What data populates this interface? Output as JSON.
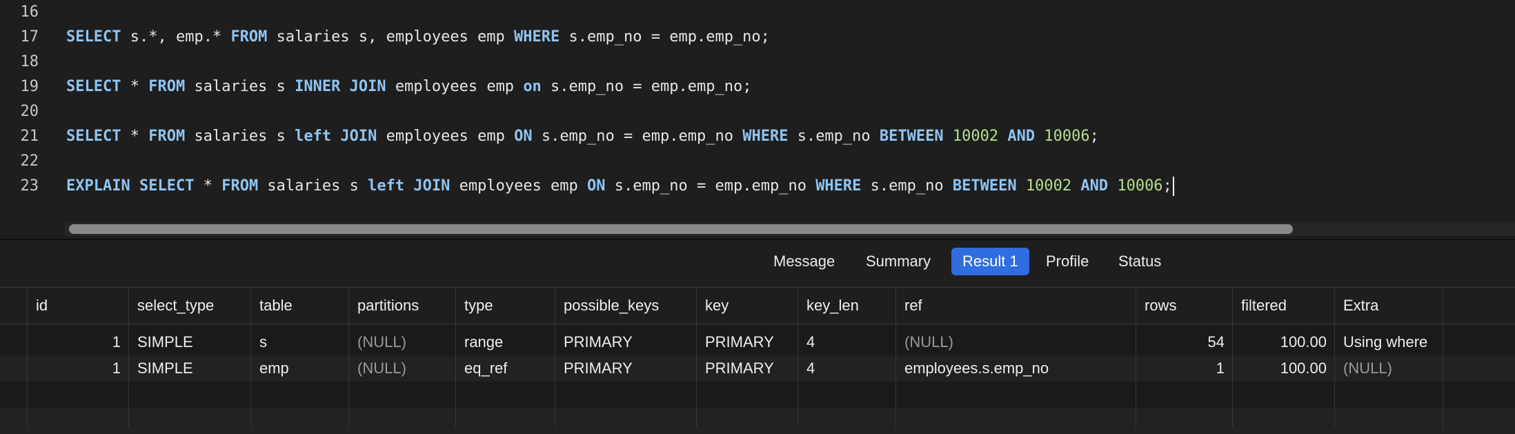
{
  "editor": {
    "lines": [
      {
        "no": "16",
        "tokens": []
      },
      {
        "no": "17",
        "tokens": [
          {
            "t": "SELECT",
            "c": "kw"
          },
          {
            "t": " s.*, emp.* ",
            "c": ""
          },
          {
            "t": "FROM",
            "c": "kw"
          },
          {
            "t": " salaries s, employees emp ",
            "c": ""
          },
          {
            "t": "WHERE",
            "c": "kw"
          },
          {
            "t": " s.emp_no = emp.emp_no;",
            "c": ""
          }
        ]
      },
      {
        "no": "18",
        "tokens": []
      },
      {
        "no": "19",
        "tokens": [
          {
            "t": "SELECT",
            "c": "kw"
          },
          {
            "t": " * ",
            "c": ""
          },
          {
            "t": "FROM",
            "c": "kw"
          },
          {
            "t": " salaries s ",
            "c": ""
          },
          {
            "t": "INNER JOIN",
            "c": "kw"
          },
          {
            "t": " employees emp ",
            "c": ""
          },
          {
            "t": "on",
            "c": "kw"
          },
          {
            "t": " s.emp_no = emp.emp_no;",
            "c": ""
          }
        ]
      },
      {
        "no": "20",
        "tokens": []
      },
      {
        "no": "21",
        "tokens": [
          {
            "t": "SELECT",
            "c": "kw"
          },
          {
            "t": " * ",
            "c": ""
          },
          {
            "t": "FROM",
            "c": "kw"
          },
          {
            "t": " salaries s ",
            "c": ""
          },
          {
            "t": "left JOIN",
            "c": "kw"
          },
          {
            "t": " employees emp ",
            "c": ""
          },
          {
            "t": "ON",
            "c": "kw"
          },
          {
            "t": " s.emp_no = emp.emp_no ",
            "c": ""
          },
          {
            "t": "WHERE",
            "c": "kw"
          },
          {
            "t": " s.emp_no ",
            "c": ""
          },
          {
            "t": "BETWEEN",
            "c": "kw"
          },
          {
            "t": " ",
            "c": ""
          },
          {
            "t": "10002",
            "c": "num"
          },
          {
            "t": " ",
            "c": ""
          },
          {
            "t": "AND",
            "c": "kw"
          },
          {
            "t": " ",
            "c": ""
          },
          {
            "t": "10006",
            "c": "num"
          },
          {
            "t": ";",
            "c": ""
          }
        ]
      },
      {
        "no": "22",
        "tokens": []
      },
      {
        "no": "23",
        "tokens": [
          {
            "t": "EXPLAIN",
            "c": "kw"
          },
          {
            "t": " ",
            "c": ""
          },
          {
            "t": "SELECT",
            "c": "kw"
          },
          {
            "t": " * ",
            "c": ""
          },
          {
            "t": "FROM",
            "c": "kw"
          },
          {
            "t": " salaries s ",
            "c": ""
          },
          {
            "t": "left JOIN",
            "c": "kw"
          },
          {
            "t": " employees emp ",
            "c": ""
          },
          {
            "t": "ON",
            "c": "kw"
          },
          {
            "t": " s.emp_no = emp.emp_no ",
            "c": ""
          },
          {
            "t": "WHERE",
            "c": "kw"
          },
          {
            "t": " s.emp_no ",
            "c": ""
          },
          {
            "t": "BETWEEN",
            "c": "kw"
          },
          {
            "t": " ",
            "c": ""
          },
          {
            "t": "10002",
            "c": "num"
          },
          {
            "t": " ",
            "c": ""
          },
          {
            "t": "AND",
            "c": "kw"
          },
          {
            "t": " ",
            "c": ""
          },
          {
            "t": "10006",
            "c": "num"
          },
          {
            "t": ";",
            "c": ""
          }
        ],
        "cursor": true
      }
    ]
  },
  "tabs": [
    {
      "label": "Message",
      "active": false
    },
    {
      "label": "Summary",
      "active": false
    },
    {
      "label": "Result 1",
      "active": true
    },
    {
      "label": "Profile",
      "active": false
    },
    {
      "label": "Status",
      "active": false
    }
  ],
  "grid": {
    "columns": [
      "id",
      "select_type",
      "table",
      "partitions",
      "type",
      "possible_keys",
      "key",
      "key_len",
      "ref",
      "rows",
      "filtered",
      "Extra"
    ],
    "rows": [
      [
        "1",
        "SIMPLE",
        "s",
        "(NULL)",
        "range",
        "PRIMARY",
        "PRIMARY",
        "4",
        "(NULL)",
        "54",
        "100.00",
        "Using where"
      ],
      [
        "1",
        "SIMPLE",
        "emp",
        "(NULL)",
        "eq_ref",
        "PRIMARY",
        "PRIMARY",
        "4",
        "employees.s.emp_no",
        "1",
        "100.00",
        "(NULL)"
      ]
    ]
  },
  "colors": {
    "keyword": "#8fc4f2",
    "number": "#b5e08a",
    "active_tab": "#2f6de1",
    "background": "#1e1e1e"
  }
}
